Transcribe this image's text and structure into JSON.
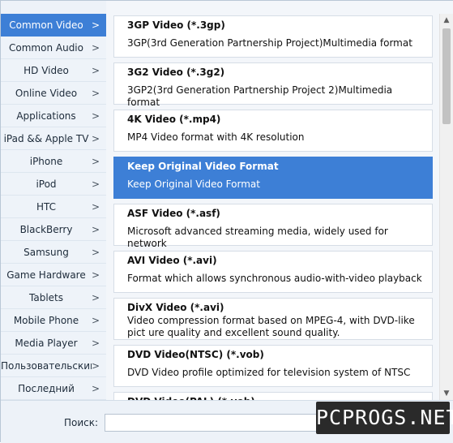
{
  "sidebar": {
    "items": [
      {
        "label": "Common Video",
        "active": true
      },
      {
        "label": "Common Audio"
      },
      {
        "label": "HD Video"
      },
      {
        "label": "Online Video"
      },
      {
        "label": "Applications"
      },
      {
        "label": "iPad && Apple TV"
      },
      {
        "label": "iPhone"
      },
      {
        "label": "iPod"
      },
      {
        "label": "HTC"
      },
      {
        "label": "BlackBerry"
      },
      {
        "label": "Samsung"
      },
      {
        "label": "Game Hardware"
      },
      {
        "label": "Tablets"
      },
      {
        "label": "Mobile Phone"
      },
      {
        "label": "Media Player"
      },
      {
        "label": "Пользовательский"
      },
      {
        "label": "Последний"
      }
    ],
    "chevron": ">"
  },
  "formats": [
    {
      "title": "3GP Video (*.3gp)",
      "desc": "3GP(3rd Generation Partnership Project)Multimedia format"
    },
    {
      "title": "3G2 Video (*.3g2)",
      "desc": "3GP2(3rd Generation Partnership Project 2)Multimedia format"
    },
    {
      "title": "4K Video (*.mp4)",
      "desc": "MP4 Video format with 4K resolution"
    },
    {
      "title": "Keep Original Video Format",
      "desc": "Keep Original Video Format",
      "selected": true
    },
    {
      "title": "ASF Video (*.asf)",
      "desc": "Microsoft advanced streaming media, widely used for network"
    },
    {
      "title": "AVI Video (*.avi)",
      "desc": "Format which allows synchronous audio-with-video playback"
    },
    {
      "title": "DivX Video (*.avi)",
      "desc": "Video compression format based on MPEG-4, with DVD-like pict ure quality and excellent sound quality."
    },
    {
      "title": "DVD Video(NTSC) (*.vob)",
      "desc": "DVD Video profile optimized for television system of NTSC"
    },
    {
      "title": "DVD Video(PAL) (*.vob)",
      "desc": ""
    }
  ],
  "search": {
    "label": "Поиск:",
    "value": ""
  },
  "watermark": "PCPROGS.NET",
  "colors": {
    "accent": "#3d7fd6"
  }
}
